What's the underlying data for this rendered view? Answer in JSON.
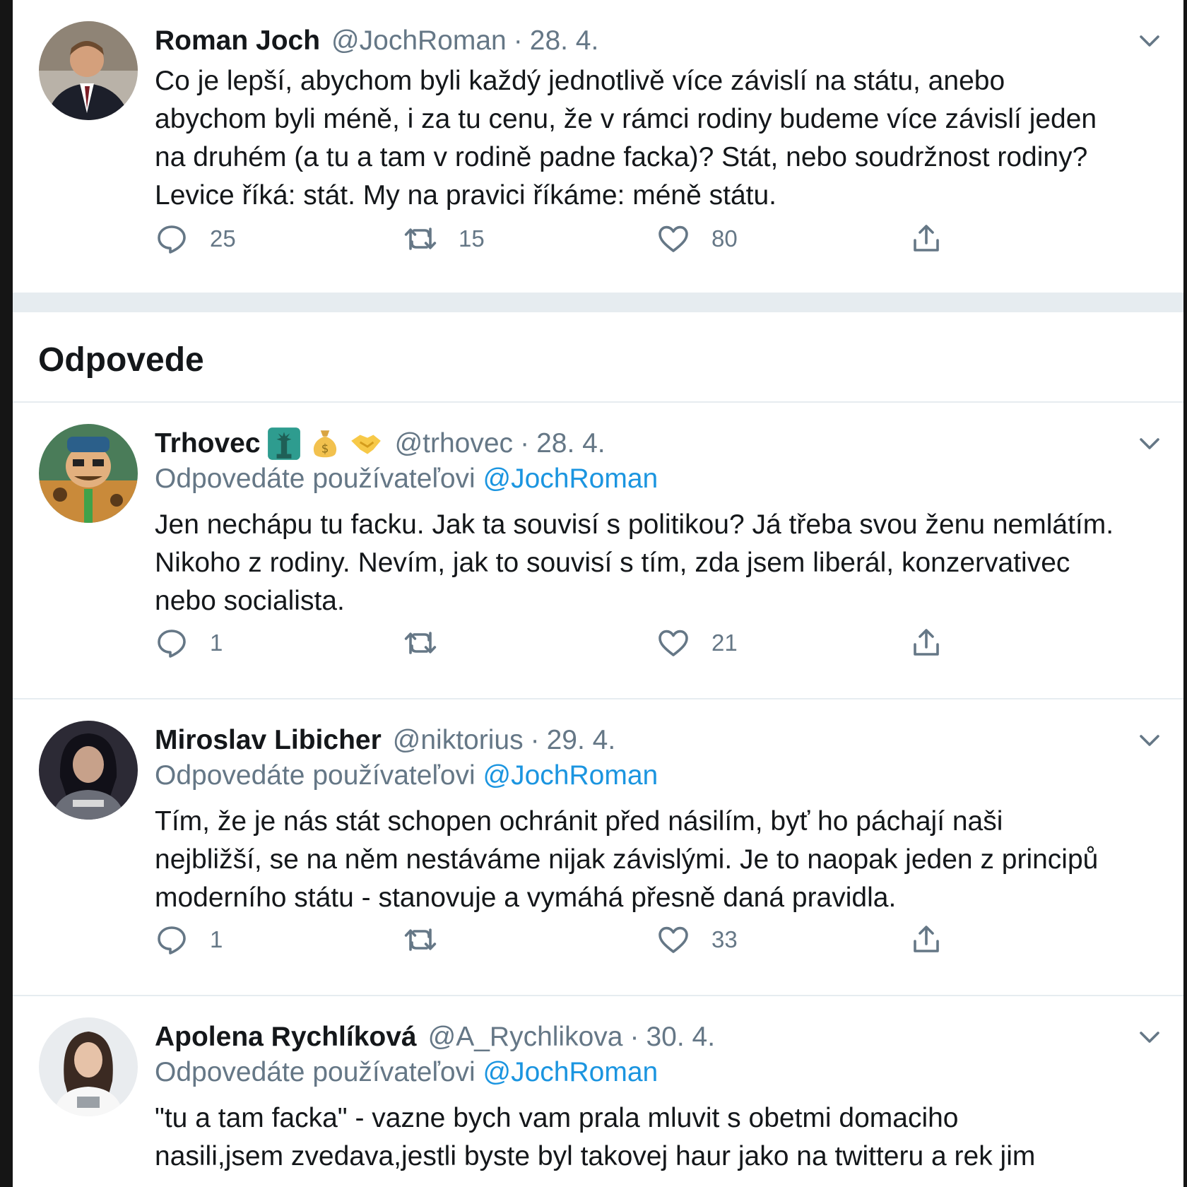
{
  "main_tweet": {
    "name": "Roman Joch",
    "handle": "@JochRoman",
    "date": "28. 4.",
    "text": "Co je lepší, abychom byli každý jednotlivě více závislí na státu, anebo\nabychom byli méně, i za tu cenu, že v rámci rodiny budeme více závislí jeden\nna druhém (a tu a tam v rodině padne facka)? Stát, nebo soudržnost rodiny?\nLevice říká: stát. My na pravici říkáme: méně státu.",
    "replies": "25",
    "retweets": "15",
    "likes": "80"
  },
  "replies_heading": "Odpovede",
  "replying_to_label": "Odpovedáte používateľovi",
  "reply_tweets": [
    {
      "name": "Trhovec",
      "handle": "@trhovec",
      "date": "28. 4.",
      "replying_to": "@JochRoman",
      "emojis": [
        "statue-of-liberty-emoji",
        "money-bag-emoji",
        "handshake-emoji"
      ],
      "text": "Jen nechápu tu facku. Jak ta souvisí s politikou? Já třeba svou ženu nemlátím.\nNikoho z rodiny. Nevím, jak to souvisí s tím, zda jsem liberál, konzervativec\nnebo socialista.",
      "replies": "1",
      "retweets": "",
      "likes": "21"
    },
    {
      "name": "Miroslav Libicher",
      "handle": "@niktorius",
      "date": "29. 4.",
      "replying_to": "@JochRoman",
      "text": "Tím, že je nás stát schopen ochránit před násilím, byť ho páchají naši\nnejbližší, se na něm nestáváme nijak závislými. Je to naopak jeden z principů\nmoderního státu - stanovuje a vymáhá přesně daná pravidla.",
      "replies": "1",
      "retweets": "",
      "likes": "33"
    },
    {
      "name": "Apolena Rychlíková",
      "handle": "@A_Rychlikova",
      "date": "30. 4.",
      "replying_to": "@JochRoman",
      "text": "\"tu a tam facka\" - vazne bych vam prala mluvit s obetmi domaciho\nnasili,jsem zvedava,jestli byste byl takovej haur jako na twitteru a rek jim"
    }
  ],
  "colors": {
    "text": "#14171a",
    "secondary": "#657786",
    "link": "#1b95e0",
    "divider": "#e6ecf0"
  }
}
